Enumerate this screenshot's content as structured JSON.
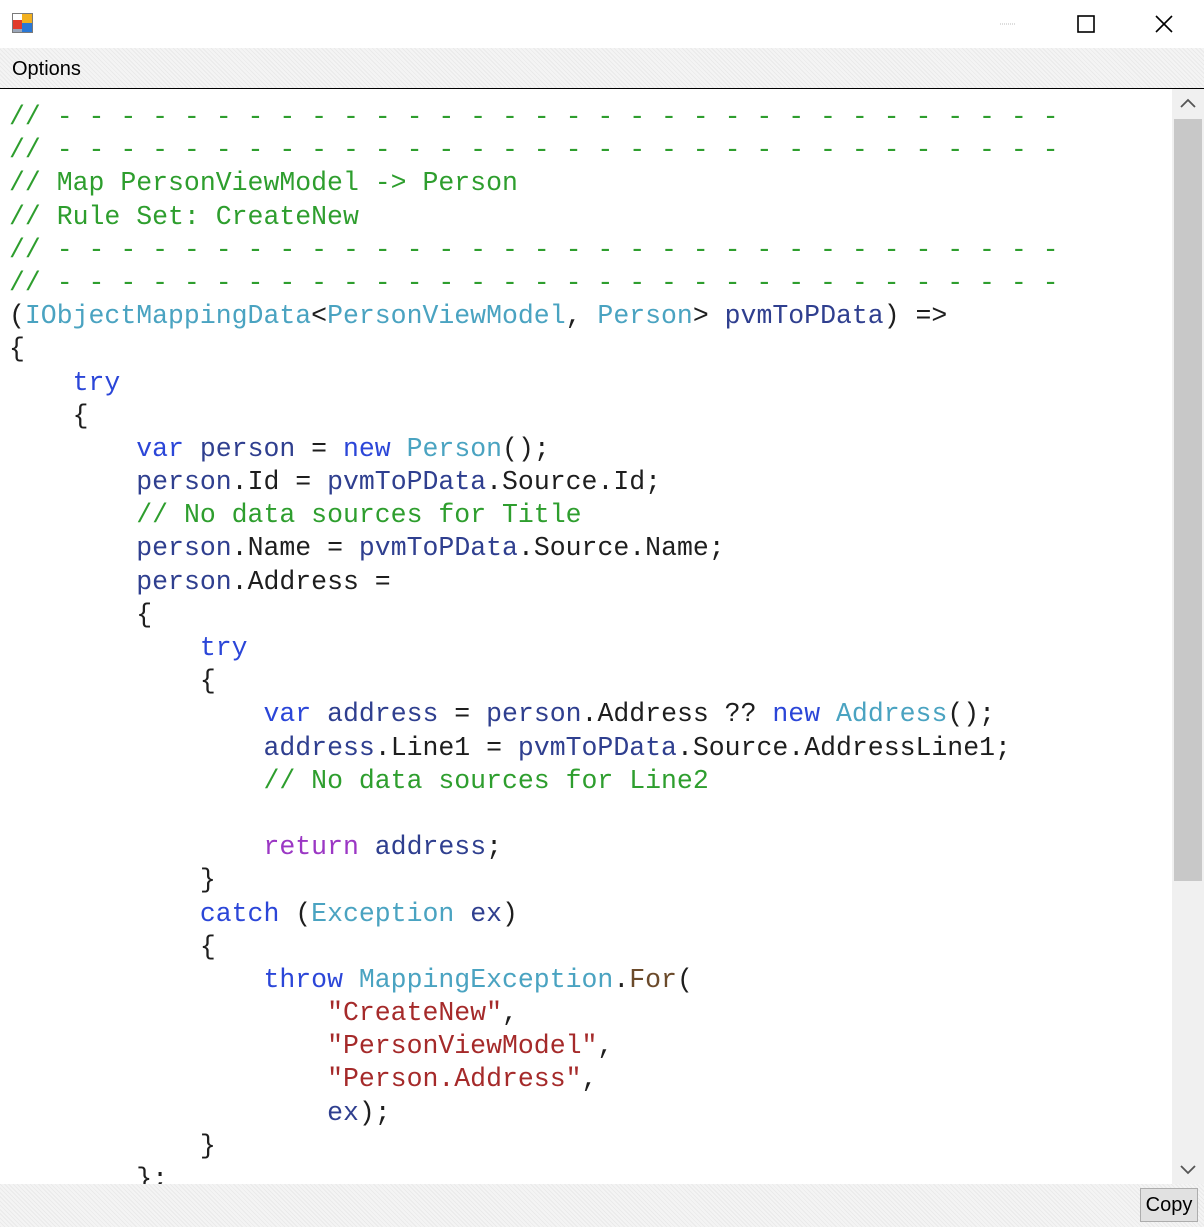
{
  "window": {
    "app_icon": "windows-form-icon",
    "min_icon": "minimize-icon",
    "max_icon": "maximize-icon",
    "close_icon": "close-icon"
  },
  "menu": {
    "options_label": "Options"
  },
  "code_lines": [
    [
      [
        "c",
        "// - - - - - - - - - - - - - - - - - - - - - - - - - - - - - - - -"
      ]
    ],
    [
      [
        "c",
        "// - - - - - - - - - - - - - - - - - - - - - - - - - - - - - - - -"
      ]
    ],
    [
      [
        "c",
        "// Map PersonViewModel -> Person"
      ]
    ],
    [
      [
        "c",
        "// Rule Set: CreateNew"
      ]
    ],
    [
      [
        "c",
        "// - - - - - - - - - - - - - - - - - - - - - - - - - - - - - - - -"
      ]
    ],
    [
      [
        "c",
        "// - - - - - - - - - - - - - - - - - - - - - - - - - - - - - - - -"
      ]
    ],
    [
      [
        "p",
        "("
      ],
      [
        "t",
        "IObjectMappingData"
      ],
      [
        "p",
        "<"
      ],
      [
        "t",
        "PersonViewModel"
      ],
      [
        "p",
        ", "
      ],
      [
        "t",
        "Person"
      ],
      [
        "p",
        "> "
      ],
      [
        "v",
        "pvmToPData"
      ],
      [
        "p",
        ") =>"
      ]
    ],
    [
      [
        "p",
        "{"
      ]
    ],
    [
      [
        "p",
        "    "
      ],
      [
        "k",
        "try"
      ]
    ],
    [
      [
        "p",
        "    {"
      ]
    ],
    [
      [
        "p",
        "        "
      ],
      [
        "k",
        "var"
      ],
      [
        "p",
        " "
      ],
      [
        "v",
        "person"
      ],
      [
        "p",
        " = "
      ],
      [
        "k",
        "new"
      ],
      [
        "p",
        " "
      ],
      [
        "t",
        "Person"
      ],
      [
        "p",
        "();"
      ]
    ],
    [
      [
        "p",
        "        "
      ],
      [
        "v",
        "person"
      ],
      [
        "p",
        "."
      ],
      [
        "p",
        "Id"
      ],
      [
        "p",
        " = "
      ],
      [
        "v",
        "pvmToPData"
      ],
      [
        "p",
        "."
      ],
      [
        "p",
        "Source"
      ],
      [
        "p",
        "."
      ],
      [
        "p",
        "Id"
      ],
      [
        "p",
        ";"
      ]
    ],
    [
      [
        "p",
        "        "
      ],
      [
        "c",
        "// No data sources for Title"
      ]
    ],
    [
      [
        "p",
        "        "
      ],
      [
        "v",
        "person"
      ],
      [
        "p",
        "."
      ],
      [
        "p",
        "Name"
      ],
      [
        "p",
        " = "
      ],
      [
        "v",
        "pvmToPData"
      ],
      [
        "p",
        "."
      ],
      [
        "p",
        "Source"
      ],
      [
        "p",
        "."
      ],
      [
        "p",
        "Name"
      ],
      [
        "p",
        ";"
      ]
    ],
    [
      [
        "p",
        "        "
      ],
      [
        "v",
        "person"
      ],
      [
        "p",
        "."
      ],
      [
        "p",
        "Address"
      ],
      [
        "p",
        " ="
      ]
    ],
    [
      [
        "p",
        "        {"
      ]
    ],
    [
      [
        "p",
        "            "
      ],
      [
        "k",
        "try"
      ]
    ],
    [
      [
        "p",
        "            {"
      ]
    ],
    [
      [
        "p",
        "                "
      ],
      [
        "k",
        "var"
      ],
      [
        "p",
        " "
      ],
      [
        "v",
        "address"
      ],
      [
        "p",
        " = "
      ],
      [
        "v",
        "person"
      ],
      [
        "p",
        "."
      ],
      [
        "p",
        "Address"
      ],
      [
        "p",
        " ?? "
      ],
      [
        "k",
        "new"
      ],
      [
        "p",
        " "
      ],
      [
        "t",
        "Address"
      ],
      [
        "p",
        "();"
      ]
    ],
    [
      [
        "p",
        "                "
      ],
      [
        "v",
        "address"
      ],
      [
        "p",
        "."
      ],
      [
        "p",
        "Line1"
      ],
      [
        "p",
        " = "
      ],
      [
        "v",
        "pvmToPData"
      ],
      [
        "p",
        "."
      ],
      [
        "p",
        "Source"
      ],
      [
        "p",
        "."
      ],
      [
        "p",
        "AddressLine1"
      ],
      [
        "p",
        ";"
      ]
    ],
    [
      [
        "p",
        "                "
      ],
      [
        "c",
        "// No data sources for Line2"
      ]
    ],
    [
      [
        "p",
        ""
      ]
    ],
    [
      [
        "p",
        "                "
      ],
      [
        "r",
        "return"
      ],
      [
        "p",
        " "
      ],
      [
        "v",
        "address"
      ],
      [
        "p",
        ";"
      ]
    ],
    [
      [
        "p",
        "            }"
      ]
    ],
    [
      [
        "p",
        "            "
      ],
      [
        "k",
        "catch"
      ],
      [
        "p",
        " ("
      ],
      [
        "t",
        "Exception"
      ],
      [
        "p",
        " "
      ],
      [
        "v",
        "ex"
      ],
      [
        "p",
        ")"
      ]
    ],
    [
      [
        "p",
        "            {"
      ]
    ],
    [
      [
        "p",
        "                "
      ],
      [
        "k",
        "throw"
      ],
      [
        "p",
        " "
      ],
      [
        "t",
        "MappingException"
      ],
      [
        "p",
        "."
      ],
      [
        "m",
        "For"
      ],
      [
        "p",
        "("
      ]
    ],
    [
      [
        "p",
        "                    "
      ],
      [
        "s",
        "\"CreateNew\""
      ],
      [
        "p",
        ","
      ]
    ],
    [
      [
        "p",
        "                    "
      ],
      [
        "s",
        "\"PersonViewModel\""
      ],
      [
        "p",
        ","
      ]
    ],
    [
      [
        "p",
        "                    "
      ],
      [
        "s",
        "\"Person.Address\""
      ],
      [
        "p",
        ","
      ]
    ],
    [
      [
        "p",
        "                    "
      ],
      [
        "v",
        "ex"
      ],
      [
        "p",
        ");"
      ]
    ],
    [
      [
        "p",
        "            }"
      ]
    ],
    [
      [
        "p",
        "        };"
      ]
    ]
  ],
  "scrollbar": {
    "up_icon": "chevron-up-icon",
    "down_icon": "chevron-down-icon"
  },
  "footer": {
    "copy_label": "Copy"
  }
}
